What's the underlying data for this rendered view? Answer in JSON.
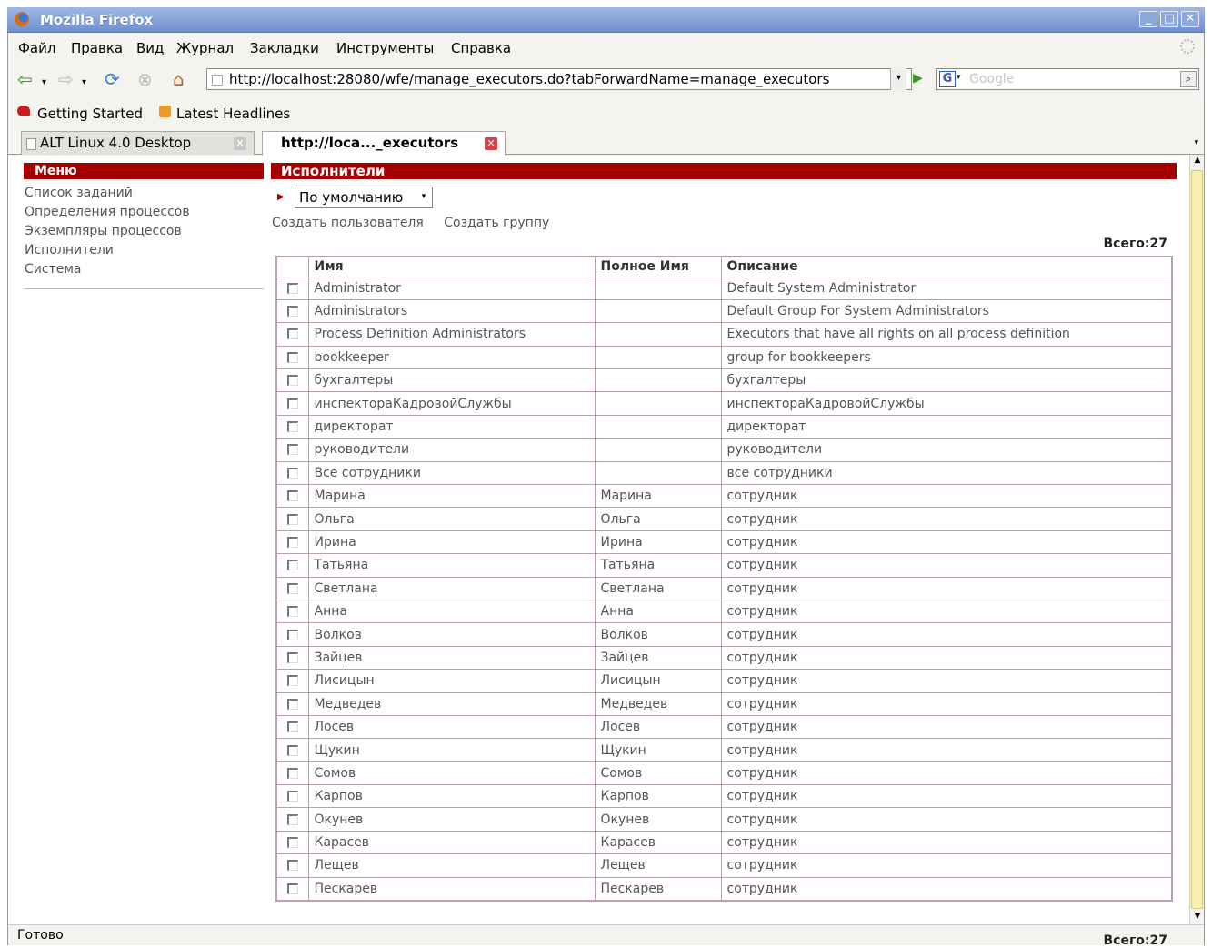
{
  "window": {
    "title": "Mozilla Firefox",
    "buttons": [
      "_",
      "□",
      "✕"
    ]
  },
  "menubar": [
    "Файл",
    "Правка",
    "Вид",
    "Журнал",
    "Закладки",
    "Инструменты",
    "Справка"
  ],
  "nav": {
    "url": "http://localhost:28080/wfe/manage_executors.do?tabForwardName=manage_executors",
    "search_placeholder": "Google"
  },
  "bookmarks": [
    "Getting Started",
    "Latest Headlines"
  ],
  "tabs": [
    {
      "label": "ALT Linux 4.0 Desktop"
    },
    {
      "label": "http://loca..._executors"
    }
  ],
  "sidebar": {
    "title": "Меню",
    "items": [
      "Список заданий",
      "Определения процессов",
      "Экземпляры процессов",
      "Исполнители",
      "Система"
    ]
  },
  "main": {
    "title": "Исполнители",
    "filter_value": "По умолчанию",
    "actions": [
      "Создать пользователя",
      "Создать группу"
    ],
    "total": "Всего:27",
    "columns": [
      "Имя",
      "Полное Имя",
      "Описание"
    ],
    "rows": [
      [
        "Administrator",
        "",
        "Default System Administrator"
      ],
      [
        "Administrators",
        "",
        "Default Group For System Administrators"
      ],
      [
        "Process Definition Administrators",
        "",
        "Executors that have all rights on all process definition"
      ],
      [
        "bookkeeper",
        "",
        "group for bookkeepers"
      ],
      [
        "бухгалтеры",
        "",
        "бухгалтеры"
      ],
      [
        "инспектораКадровойСлужбы",
        "",
        "инспектораКадровойСлужбы"
      ],
      [
        "директорат",
        "",
        "директорат"
      ],
      [
        "руководители",
        "",
        "руководители"
      ],
      [
        "Все сотрудники",
        "",
        "все сотрудники"
      ],
      [
        "Марина",
        "Марина",
        "сотрудник"
      ],
      [
        "Ольга",
        "Ольга",
        "сотрудник"
      ],
      [
        "Ирина",
        "Ирина",
        "сотрудник"
      ],
      [
        "Татьяна",
        "Татьяна",
        "сотрудник"
      ],
      [
        "Светлана",
        "Светлана",
        "сотрудник"
      ],
      [
        "Анна",
        "Анна",
        "сотрудник"
      ],
      [
        "Волков",
        "Волков",
        "сотрудник"
      ],
      [
        "Зайцев",
        "Зайцев",
        "сотрудник"
      ],
      [
        "Лисицын",
        "Лисицын",
        "сотрудник"
      ],
      [
        "Медведев",
        "Медведев",
        "сотрудник"
      ],
      [
        "Лосев",
        "Лосев",
        "сотрудник"
      ],
      [
        "Щукин",
        "Щукин",
        "сотрудник"
      ],
      [
        "Сомов",
        "Сомов",
        "сотрудник"
      ],
      [
        "Карпов",
        "Карпов",
        "сотрудник"
      ],
      [
        "Окунев",
        "Окунев",
        "сотрудник"
      ],
      [
        "Карасев",
        "Карасев",
        "сотрудник"
      ],
      [
        "Лещев",
        "Лещев",
        "сотрудник"
      ],
      [
        "Пескарев",
        "Пескарев",
        "сотрудник"
      ]
    ]
  },
  "status": "Готово",
  "colors": {
    "accent": "#a50000",
    "titlebar": "#7f9dd8",
    "table_border": "#b89fb5",
    "scroll_thumb": "#f8f0b0"
  }
}
